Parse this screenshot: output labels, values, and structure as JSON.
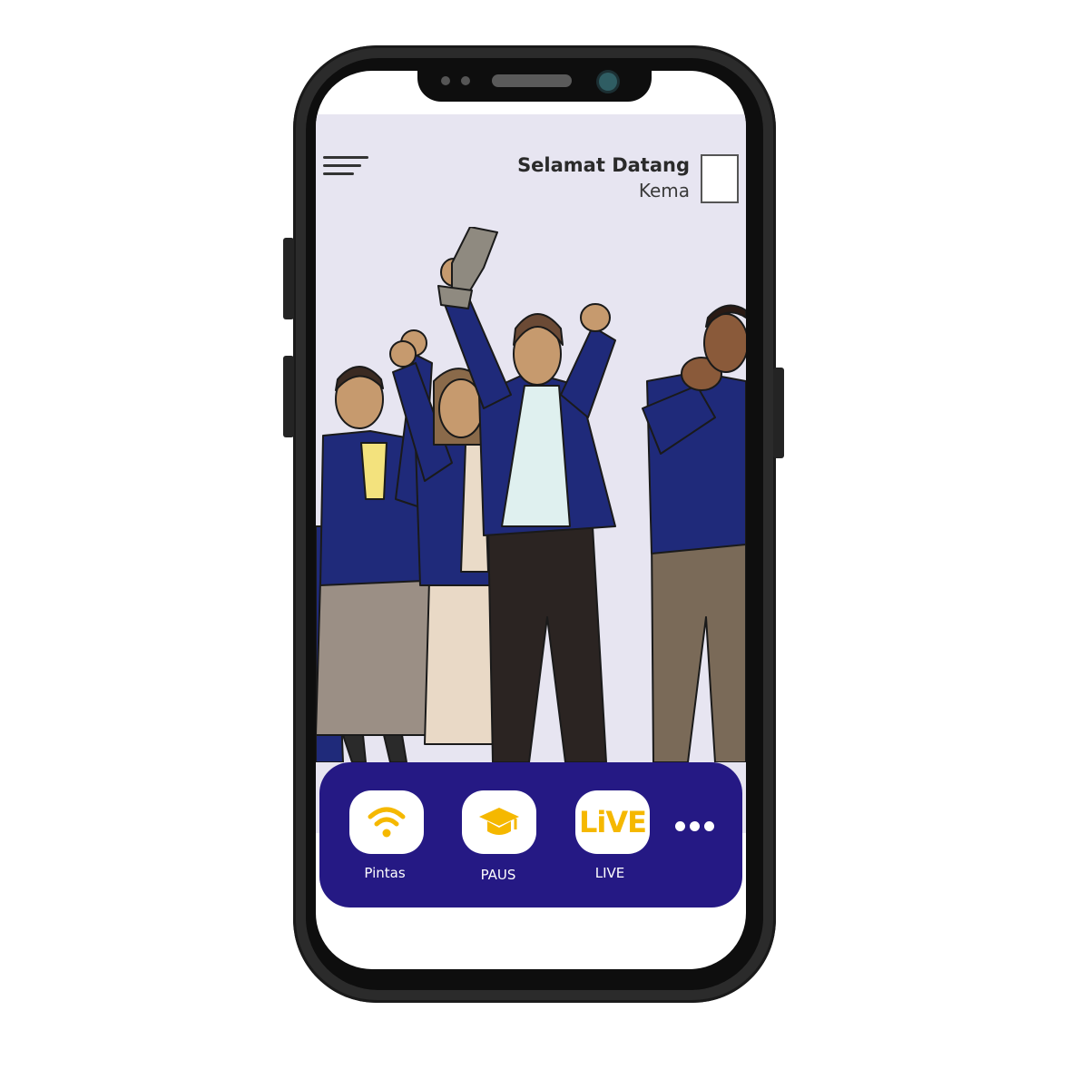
{
  "header": {
    "greeting": "Selamat Datang",
    "user_name": "Kema"
  },
  "dock": {
    "items": [
      {
        "label": "Pintas",
        "icon": "wifi-icon"
      },
      {
        "label": "PAUS",
        "icon": "graduation-cap-icon"
      },
      {
        "label": "LIVE",
        "icon": "live-icon",
        "icon_text": "LiVE"
      }
    ],
    "more_icon": "more-dots-icon"
  },
  "colors": {
    "dock_background": "#251984",
    "icon_accent": "#f5b800",
    "screen_background": "#e7e5f1",
    "jacket": "#1f2a7a"
  }
}
